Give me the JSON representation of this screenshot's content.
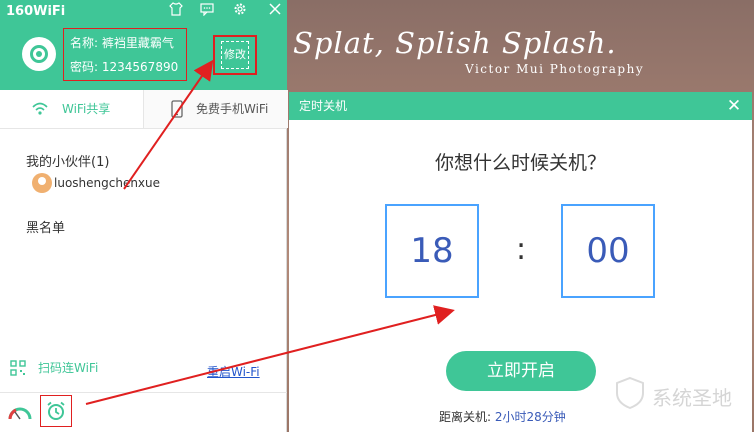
{
  "background": {
    "title": "Splat, Splish Splash.",
    "credit": "Victor Mui Photography"
  },
  "app": {
    "title": "160WiFi",
    "titlebar_icons": [
      "tshirt-icon",
      "message-icon",
      "gear-icon",
      "close-icon"
    ],
    "name_label": "名称:",
    "name_value": "裤裆里藏霸气",
    "password_label": "密码:",
    "password_value": "1234567890",
    "edit_label": "修改",
    "tabs": [
      {
        "label": "WiFi共享",
        "icon": "wifi-icon",
        "active": true
      },
      {
        "label": "免费手机WiFi",
        "icon": "phone-icon",
        "active": false
      }
    ],
    "friends_title": "我的小伙伴(1)",
    "friend_name": "luoshengchenxue",
    "blacklist": "黑名单",
    "scan_label": "扫码连WiFi",
    "restart_label": "重启Wi-Fi"
  },
  "dialog": {
    "title": "定时关机",
    "question": "你想什么时候关机？",
    "hour": "18",
    "colon": ":",
    "minute": "00",
    "start_button": "立即开启",
    "remain_label": "距离关机:",
    "remain_value": "2小时28分钟"
  },
  "watermark": {
    "text": "系统圣地"
  },
  "colors": {
    "accent": "#3fc697",
    "annotation": "#e02020",
    "time_border": "#4aa3ff",
    "time_text": "#3a5bb8"
  }
}
